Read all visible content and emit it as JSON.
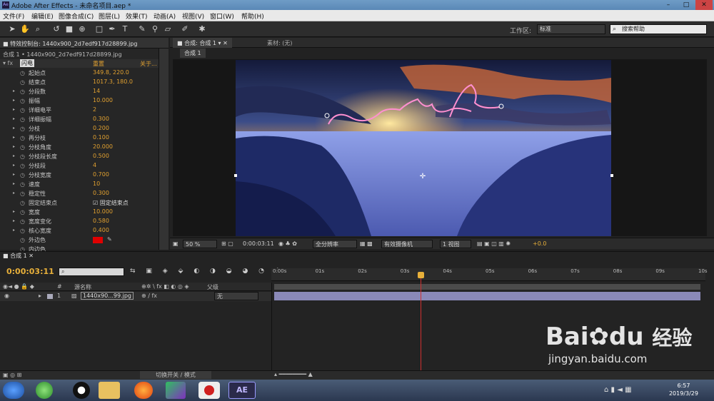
{
  "window": {
    "title": "Adobe After Effects - 未命名项目.aep *",
    "app_icon": "Ae",
    "minimize": "–",
    "maximize": "□",
    "close": "✕"
  },
  "menu": [
    "文件(F)",
    "编辑(E)",
    "图像合成(C)",
    "图层(L)",
    "效果(T)",
    "动画(A)",
    "视图(V)",
    "窗口(W)",
    "帮助(H)"
  ],
  "toolbar": {
    "tools": [
      "selection-icon",
      "hand-icon",
      "zoom-icon",
      "rotate-icon",
      "camera-icon",
      "pan-behind-icon",
      "rect-mask-icon",
      "pen-icon",
      "text-icon",
      "brush-icon",
      "clone-icon",
      "eraser-icon",
      "roto-icon",
      "puppet-icon"
    ],
    "workspace_label": "工作区:",
    "workspace_value": "标准",
    "search_placeholder": "搜索帮助"
  },
  "effects_panel": {
    "tab": "特效控制台: 1440x900_2d7edf917d28899.jpg",
    "subtitle": "合成 1 • 1440x900_2d7edf917d28899.jpg",
    "effect_name": "闪电",
    "reset": "重置",
    "about": "关于...",
    "rows": [
      {
        "name": "起始点",
        "value": "349.8, 220.0",
        "expand": false
      },
      {
        "name": "结束点",
        "value": "1017.3, 180.0",
        "expand": false
      },
      {
        "name": "分段数",
        "value": "14",
        "expand": true
      },
      {
        "name": "振幅",
        "value": "10.000",
        "expand": true
      },
      {
        "name": "详细电平",
        "value": "2",
        "expand": true
      },
      {
        "name": "详细振幅",
        "value": "0.300",
        "expand": true
      },
      {
        "name": "分枝",
        "value": "0.200",
        "expand": true
      },
      {
        "name": "再分枝",
        "value": "0.100",
        "expand": true
      },
      {
        "name": "分枝角度",
        "value": "20.000",
        "expand": true
      },
      {
        "name": "分枝段长度",
        "value": "0.500",
        "expand": true
      },
      {
        "name": "分枝段",
        "value": "4",
        "expand": true
      },
      {
        "name": "分枝宽度",
        "value": "0.700",
        "expand": true
      },
      {
        "name": "速度",
        "value": "10",
        "expand": true
      },
      {
        "name": "稳定性",
        "value": "0.300",
        "expand": true
      },
      {
        "name": "固定结束点",
        "value": "固定结束点",
        "expand": false,
        "checkbox": true
      },
      {
        "name": "宽度",
        "value": "10.000",
        "expand": true
      },
      {
        "name": "宽度变化",
        "value": "0.580",
        "expand": true
      },
      {
        "name": "核心宽度",
        "value": "0.400",
        "expand": true
      },
      {
        "name": "外边色",
        "value": "",
        "expand": false,
        "color": "#e00000"
      },
      {
        "name": "内边色",
        "value": "",
        "expand": false
      }
    ]
  },
  "comp_panel": {
    "tab": "合成: 合成 1",
    "footage_tab": "素材: (无)",
    "breadcrumb": "合成 1"
  },
  "viewer_bar": {
    "zoom": "50 %",
    "timecode": "0:00:03:11",
    "resolution": "全分辨率",
    "camera": "有效摄像机",
    "views": "1 视图",
    "exposure": "+0.0"
  },
  "timeline": {
    "tab": "合成 1",
    "timecode": "0:00:03:11",
    "columns": {
      "source": "源名称",
      "parent": "父级"
    },
    "ticks": [
      "0:00s",
      "01s",
      "02s",
      "03s",
      "04s",
      "05s",
      "06s",
      "07s",
      "08s",
      "09s",
      "10s"
    ],
    "layer": {
      "index": "1",
      "name": "1440x90...99.jpg",
      "parent": "无"
    },
    "bottom_label": "切换开关 / 模式"
  },
  "taskbar": {
    "time": "6:57",
    "date": "2019/3/29",
    "ae": "AE"
  },
  "watermark": {
    "brand": "Bai",
    "brand2": "du",
    "text2": "经验",
    "url": "jingyan.baidu.com"
  },
  "colors": {
    "accent": "#e8b03a",
    "playhead": "#d03030",
    "layerbar": "#8a89b8"
  }
}
